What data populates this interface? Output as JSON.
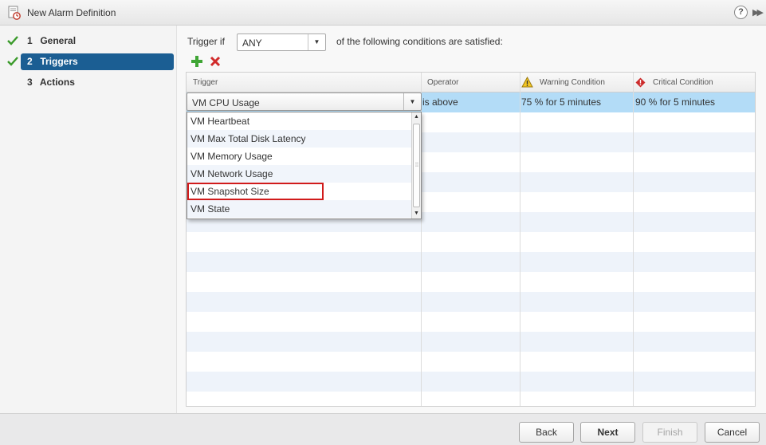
{
  "window": {
    "title": "New Alarm Definition",
    "help_icon": "?",
    "expand_icon": "▶▶"
  },
  "sidebar": {
    "steps": [
      {
        "num": "1",
        "label": "General",
        "done": true
      },
      {
        "num": "2",
        "label": "Triggers",
        "done": true,
        "active": true
      },
      {
        "num": "3",
        "label": "Actions",
        "done": false
      }
    ]
  },
  "triggers": {
    "trigger_if_label": "Trigger if",
    "match_select": "ANY",
    "conditions_text": "of the following conditions are satisfied:",
    "add_icon": "plus-icon",
    "remove_icon": "delete-icon",
    "columns": [
      "Trigger",
      "Operator",
      "Warning Condition",
      "Critical Condition"
    ],
    "selected_row": {
      "trigger": "VM CPU Usage",
      "operator": "is above",
      "warning": "75 % for 5 minutes",
      "critical": "90 % for 5 minutes"
    },
    "dropdown_options": [
      "VM Heartbeat",
      "VM Max Total Disk Latency",
      "VM Memory Usage",
      "VM Network Usage",
      "VM Snapshot Size",
      "VM State"
    ],
    "highlighted_option": "VM Snapshot Size"
  },
  "footer": {
    "back": "Back",
    "next": "Next",
    "finish": "Finish",
    "cancel": "Cancel"
  },
  "colors": {
    "active_step": "#1b5e93",
    "selected_row": "#b3dcf7",
    "check": "#3a9a2a",
    "highlight_box": "#d11b1b"
  }
}
